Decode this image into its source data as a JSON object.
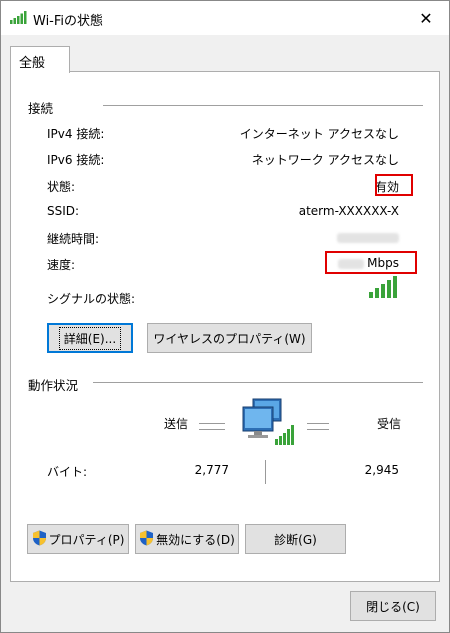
{
  "window": {
    "title": "Wi-Fiの状態",
    "close_glyph": "✕"
  },
  "tab": {
    "label": "全般"
  },
  "connection": {
    "section_label": "接続",
    "rows": [
      {
        "label": "IPv4 接続:",
        "value": "インターネット アクセスなし"
      },
      {
        "label": "IPv6 接続:",
        "value": "ネットワーク アクセスなし"
      },
      {
        "label": "状態:",
        "value": "有効"
      },
      {
        "label": "SSID:",
        "value": "aterm-XXXXXX-X"
      },
      {
        "label": "継続時間:",
        "value": ""
      },
      {
        "label": "速度:",
        "value": "Mbps"
      },
      {
        "label": "シグナルの状態:",
        "value": ""
      }
    ],
    "signal_bars": 5,
    "details_button": "詳細(E)...",
    "wireless_props_button": "ワイヤレスのプロパティ(W)"
  },
  "activity": {
    "section_label": "動作状況",
    "sent_label": "送信",
    "received_label": "受信",
    "bytes_label": "バイト:",
    "sent_value": "2,777",
    "received_value": "2,945"
  },
  "buttons": {
    "properties": "プロパティ(P)",
    "disable": "無効にする(D)",
    "diagnose": "診断(G)",
    "close": "閉じる(C)"
  },
  "colors": {
    "highlight": "#e00000",
    "signal": "#3aa33a",
    "accent": "#0078d7"
  }
}
